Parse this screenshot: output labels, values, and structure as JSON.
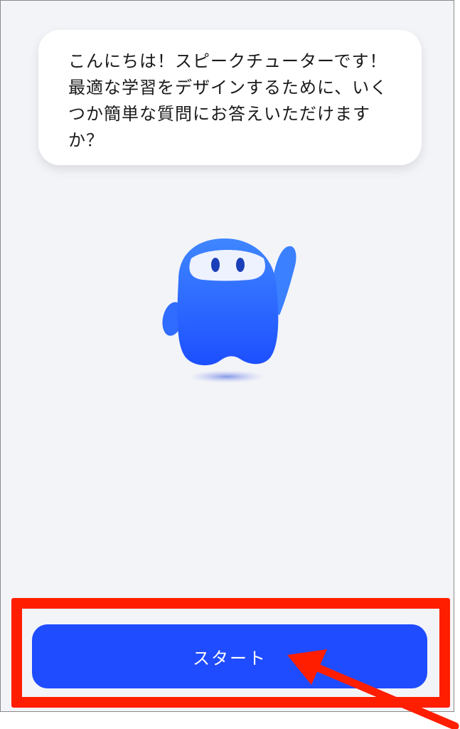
{
  "speech_bubble": {
    "text": "こんにちは！スピークチューターです！最適な学習をデザインするために、いくつか簡単な質問にお答えいただけますか？"
  },
  "mascot": {
    "icon": "waving-blue-mascot"
  },
  "start_button": {
    "label": "スタート"
  },
  "annotation": {
    "highlight_color": "#ff1e00"
  },
  "colors": {
    "background": "#f3f4f8",
    "accent": "#1f4cff"
  }
}
